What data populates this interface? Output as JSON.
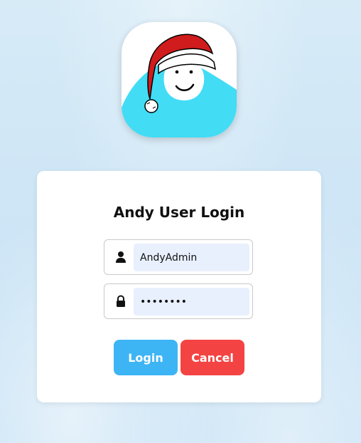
{
  "app": {
    "logo_icon": "yeti-santa-hat-logo"
  },
  "login": {
    "title": "Andy User Login",
    "username": {
      "icon": "user-icon",
      "value": "AndyAdmin"
    },
    "password": {
      "icon": "lock-icon",
      "value": "••••••••"
    },
    "buttons": {
      "login_label": "Login",
      "cancel_label": "Cancel"
    }
  },
  "colors": {
    "login_button": "#3db5f5",
    "cancel_button": "#f44343",
    "input_background": "#e8f0fe",
    "logo_fill": "#42dcf5",
    "hat_red": "#d01c1c"
  }
}
